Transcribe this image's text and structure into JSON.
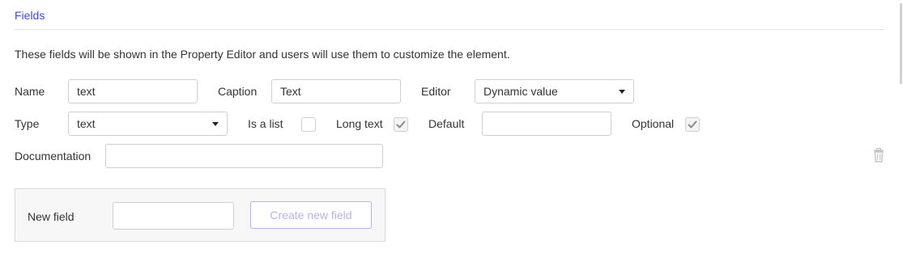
{
  "section": {
    "title": "Fields",
    "description": "These fields will be shown in the Property Editor and users will use them to customize the element."
  },
  "field": {
    "name_label": "Name",
    "name_value": "text",
    "caption_label": "Caption",
    "caption_value": "Text",
    "editor_label": "Editor",
    "editor_value": "Dynamic value",
    "type_label": "Type",
    "type_value": "text",
    "is_list_label": "Is a list",
    "is_list_checked": false,
    "long_text_label": "Long text",
    "long_text_checked": true,
    "default_label": "Default",
    "default_value": "",
    "optional_label": "Optional",
    "optional_checked": true,
    "documentation_label": "Documentation",
    "documentation_value": "",
    "delete_icon": "trash-icon"
  },
  "new_field": {
    "label": "New field",
    "value": "",
    "button_label": "Create new field"
  },
  "colors": {
    "accent": "#3a4bd6",
    "button_border": "#b3b1ee",
    "button_text": "#b5b3ea"
  }
}
